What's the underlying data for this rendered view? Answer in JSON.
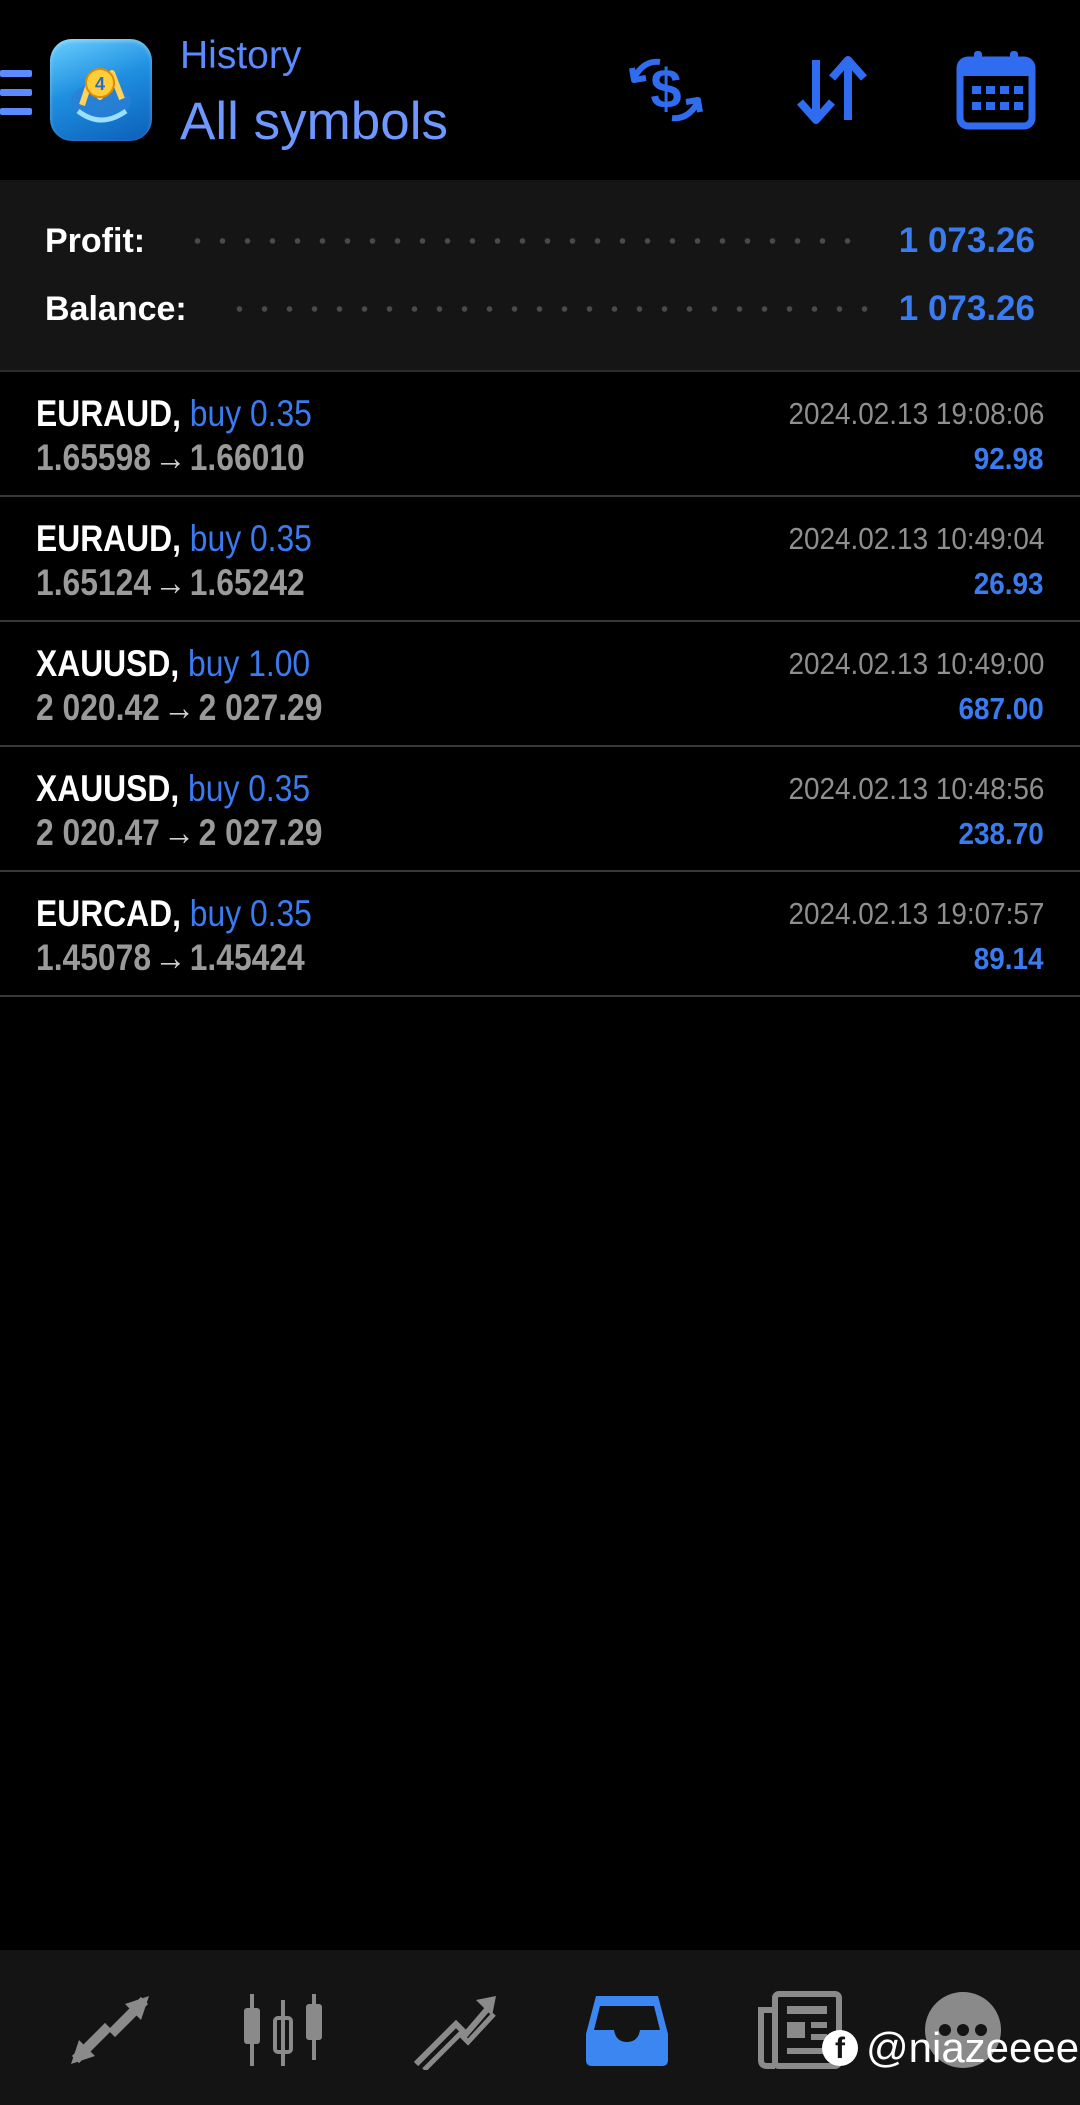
{
  "header": {
    "subtitle": "History",
    "title": "All symbols",
    "icons": {
      "deposits": "dollar-exchange-icon",
      "sort": "sort-arrows-icon",
      "calendar": "calendar-icon"
    }
  },
  "summary": {
    "profit_label": "Profit:",
    "profit_value": "1 073.26",
    "balance_label": "Balance:",
    "balance_value": "1 073.26"
  },
  "trades": [
    {
      "symbol": "EURAUD,",
      "side": "buy 0.35",
      "open": "1.65598",
      "close": "1.66010",
      "time": "2024.02.13 19:08:06",
      "profit": "92.98"
    },
    {
      "symbol": "EURAUD,",
      "side": "buy 0.35",
      "open": "1.65124",
      "close": "1.65242",
      "time": "2024.02.13 10:49:04",
      "profit": "26.93"
    },
    {
      "symbol": "XAUUSD,",
      "side": "buy 1.00",
      "open": "2 020.42",
      "close": "2 027.29",
      "time": "2024.02.13 10:49:00",
      "profit": "687.00"
    },
    {
      "symbol": "XAUUSD,",
      "side": "buy 0.35",
      "open": "2 020.47",
      "close": "2 027.29",
      "time": "2024.02.13 10:48:56",
      "profit": "238.70"
    },
    {
      "symbol": "EURCAD,",
      "side": "buy 0.35",
      "open": "1.45078",
      "close": "1.45424",
      "time": "2024.02.13 19:07:57",
      "profit": "89.14"
    }
  ],
  "arrow_glyph": "→",
  "bottom_nav": {
    "items": [
      "quotes-icon",
      "chart-icon",
      "trade-icon",
      "history-icon",
      "news-icon",
      "messages-icon"
    ],
    "active": "history-icon"
  },
  "watermark": {
    "fb_letter": "f",
    "handle": "@niazeeee"
  },
  "colors": {
    "accent": "#3b7bf0",
    "header_text": "#6e97ff",
    "background": "#000000",
    "panel": "#151515",
    "nav_inactive": "#8a8a8a"
  }
}
